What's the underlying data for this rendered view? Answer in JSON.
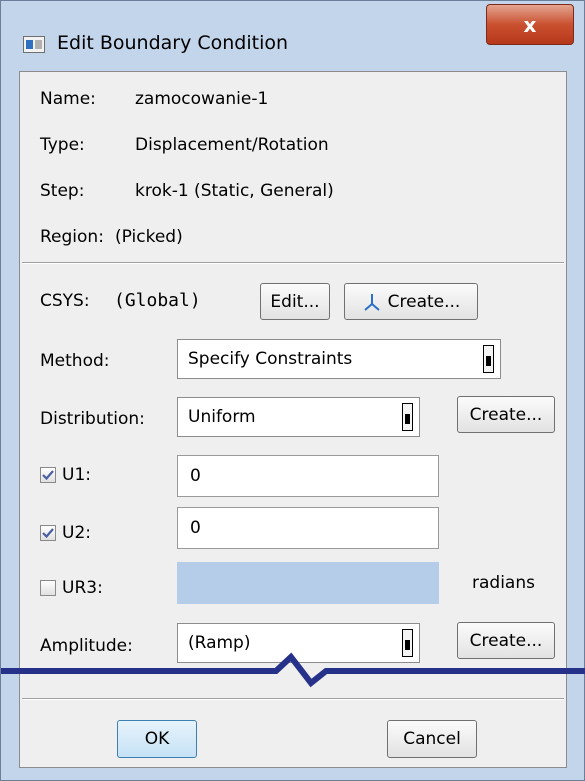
{
  "window": {
    "title": "Edit Boundary Condition",
    "close_glyph": "x",
    "colors": {
      "frame": "#c3d5ea",
      "close_button": "#c9502f",
      "disabled_field": "#b5cde8",
      "cut_line": "#26328a"
    }
  },
  "info": {
    "name_label": "Name:",
    "name_value": "zamocowanie-1",
    "type_label": "Type:",
    "type_value": "Displacement/Rotation",
    "step_label": "Step:",
    "step_value": "krok-1 (Static, General)",
    "region_label": "Region:",
    "region_value": "(Picked)"
  },
  "csys": {
    "label": "CSYS:",
    "value": "(Global)",
    "edit_button": "Edit...",
    "create_button": "Create...",
    "create_icon": "axis-triad-icon"
  },
  "method": {
    "label": "Method:",
    "value": "Specify Constraints"
  },
  "distribution": {
    "label": "Distribution:",
    "value": "Uniform",
    "create_button": "Create..."
  },
  "dofs": [
    {
      "label": "U1:",
      "checked": true,
      "value": "0"
    },
    {
      "label": "U2:",
      "checked": true,
      "value": "0"
    },
    {
      "label": "UR3:",
      "checked": false,
      "value": "",
      "unit": "radians"
    }
  ],
  "amplitude": {
    "label": "Amplitude:",
    "value": "(Ramp)",
    "create_button": "Create..."
  },
  "footer": {
    "ok_button": "OK",
    "cancel_button": "Cancel"
  }
}
